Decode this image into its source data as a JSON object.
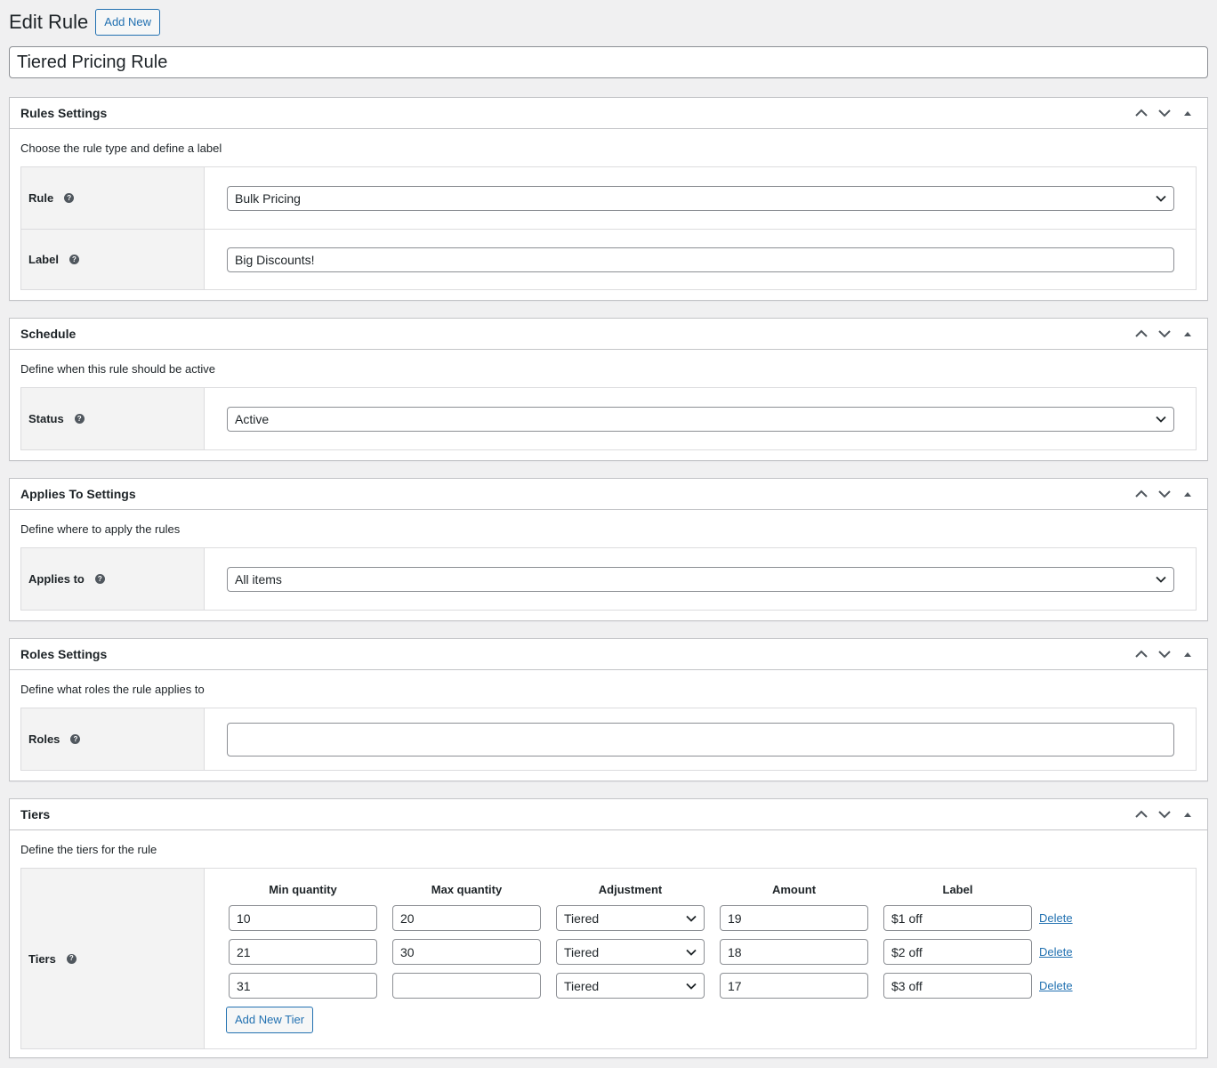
{
  "header": {
    "title": "Edit Rule",
    "add_new_label": "Add New"
  },
  "post_title": "Tiered Pricing Rule",
  "sections": {
    "rules_settings": {
      "title": "Rules Settings",
      "description": "Choose the rule type and define a label",
      "rule_label": "Rule",
      "rule_value": "Bulk Pricing",
      "label_label": "Label",
      "label_value": "Big Discounts!"
    },
    "schedule": {
      "title": "Schedule",
      "description": "Define when this rule should be active",
      "status_label": "Status",
      "status_value": "Active"
    },
    "applies_to": {
      "title": "Applies To Settings",
      "description": "Define where to apply the rules",
      "applies_label": "Applies to",
      "applies_value": "All items"
    },
    "roles": {
      "title": "Roles Settings",
      "description": "Define what roles the rule applies to",
      "roles_label": "Roles",
      "roles_value": ""
    },
    "tiers": {
      "title": "Tiers",
      "description": "Define the tiers for the rule",
      "tiers_label": "Tiers",
      "columns": [
        "Min quantity",
        "Max quantity",
        "Adjustment",
        "Amount",
        "Label"
      ],
      "rows": [
        {
          "min": "10",
          "max": "20",
          "adjustment": "Tiered",
          "amount": "19",
          "label": "$1 off",
          "delete": "Delete"
        },
        {
          "min": "21",
          "max": "30",
          "adjustment": "Tiered",
          "amount": "18",
          "label": "$2 off",
          "delete": "Delete"
        },
        {
          "min": "31",
          "max": "",
          "adjustment": "Tiered",
          "amount": "17",
          "label": "$3 off",
          "delete": "Delete"
        }
      ],
      "add_tier_label": "Add New Tier"
    }
  },
  "help_icon_glyph": "?",
  "colors": {
    "accent": "#2271b1",
    "background": "#f0f0f1",
    "border": "#c3c4c7"
  }
}
